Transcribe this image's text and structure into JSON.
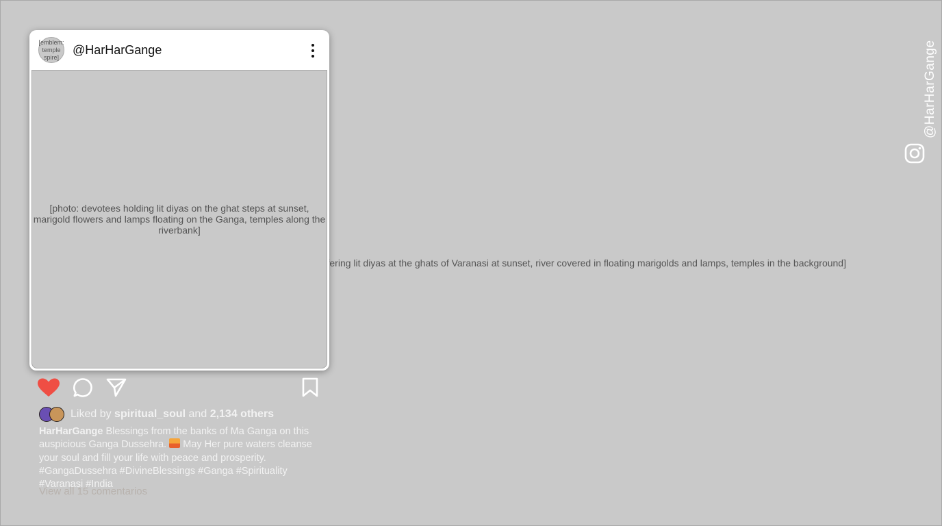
{
  "background": {
    "photo_label": "[photo: women in blue saris and men in white kurtas offering lit diyas at the ghats of Varanasi at sunset, river covered in floating marigolds and lamps, temples in the background]"
  },
  "post": {
    "avatar_label": "[emblem: temple spire]",
    "username": "@HarHarGange",
    "photo_label": "[photo: devotees holding lit diyas on the ghat steps at sunset, marigold flowers and lamps floating on the Ganga, temples along the riverbank]"
  },
  "actions": {
    "heart_color": "#ef4e44",
    "icons": [
      "heart-icon",
      "comment-icon",
      "share-icon",
      "bookmark-icon"
    ]
  },
  "likes": {
    "prefix": "Liked by",
    "user": "spiritual_soul",
    "middle": "and",
    "others": "2,134 others"
  },
  "caption": {
    "author": "HarHarGange",
    "text_before_emoji": "Blessings from the banks of Ma Ganga on this auspicious Ganga Dussehra.",
    "text_after_emoji": "May Her pure waters cleanse your soul and fill your life with peace and prosperity. #GangaDussehra #DivineBlessings #Ganga #Spirituality #Varanasi #India"
  },
  "view_comments": "View all 15 comentarios",
  "watermark": {
    "handle": "@HarHarGange",
    "icon": "instagram-icon"
  }
}
